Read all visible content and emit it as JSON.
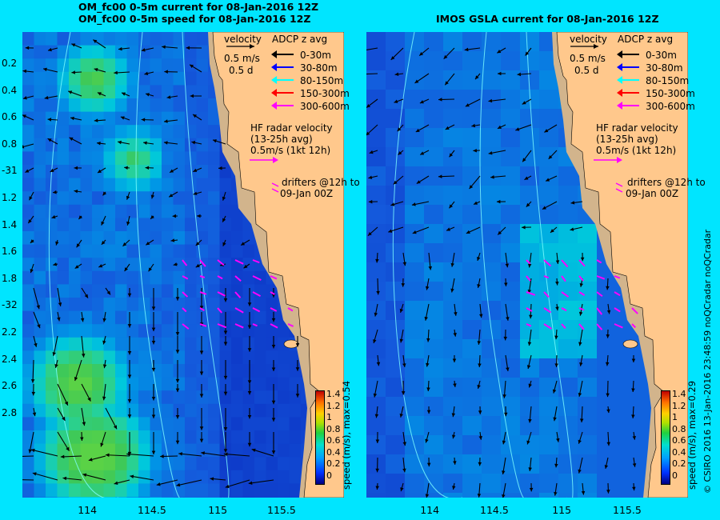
{
  "left_panel": {
    "title_line1": "OM_fc00 0-5m current for 08-Jan-2016 12Z",
    "title_line2": "OM_fc00 0-5m speed for 08-Jan-2016 12Z",
    "colorbar_label": "speed (m/s), max=0.54"
  },
  "right_panel": {
    "title_line1": "IMOS GSLA current for 08-Jan-2016 12Z",
    "colorbar_label": "speed (m/s), max=0.29"
  },
  "legend": {
    "velocity": "velocity",
    "scale1": "0.5 m/s",
    "scale2": "0.5 d",
    "adcp_title": "ADCP z avg",
    "adcp_items": [
      {
        "label": "0-30m",
        "color": "#000000"
      },
      {
        "label": "30-80m",
        "color": "#0000ff"
      },
      {
        "label": "80-150m",
        "color": "#00ffff"
      },
      {
        "label": "150-300m",
        "color": "#ff0000"
      },
      {
        "label": "300-600m",
        "color": "#ff00ff"
      }
    ],
    "hf_line1": "HF radar velocity",
    "hf_line2": "(13-25h avg)",
    "hf_line3": "0.5m/s (1kt 12h)",
    "drifters_line1": "drifters @12h to",
    "drifters_line2": "09-Jan 00Z"
  },
  "y_ticks": [
    "0.2",
    "0.4",
    "0.6",
    "0.8",
    "-31",
    "1.2",
    "1.4",
    "1.6",
    "1.8",
    "-32",
    "2.2",
    "2.4",
    "2.6",
    "2.8"
  ],
  "x_ticks": [
    "114",
    "114.5",
    "115",
    "115.5"
  ],
  "colorbar_ticks": [
    "1.4",
    "1.2",
    "1",
    "0.8",
    "0.6",
    "0.4",
    "0.2",
    "0"
  ],
  "credit": "© CSIRO 2016   13-Jan-2016 23:48:59 noQCradar noQCradar",
  "colors": {
    "background": "#00e5ff",
    "land": "#ffc88c",
    "shelf_land": "#d2b48c",
    "hf_radar": "#ff00ff"
  }
}
